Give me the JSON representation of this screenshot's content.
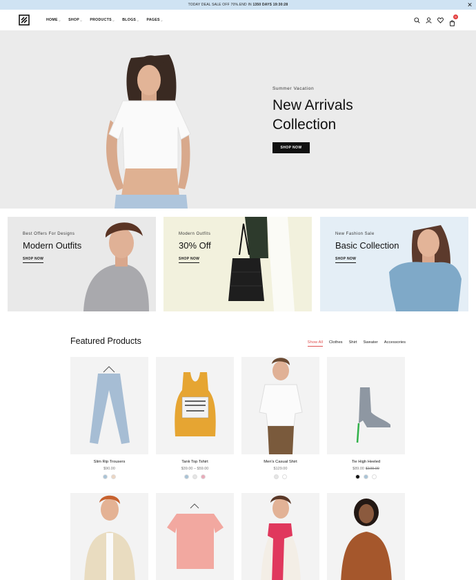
{
  "announcement": {
    "text_prefix": "TODAY DEAL SALE OFF 70%.END IN",
    "countdown": "1350 DAYS 19:30:28"
  },
  "header": {
    "nav": [
      {
        "label": "HOME"
      },
      {
        "label": "SHOP"
      },
      {
        "label": "PRODUCTS"
      },
      {
        "label": "BLOGS"
      },
      {
        "label": "PAGES"
      }
    ],
    "cart_count": "0"
  },
  "hero": {
    "subtitle": "Summer Vacation",
    "title": "New Arrivals Collection",
    "button": "SHOP NOW"
  },
  "promos": [
    {
      "subtitle": "Best Offers For Designs",
      "title": "Modern Outfits",
      "link": "SHOP NOW",
      "bg": "#e9e9e9"
    },
    {
      "subtitle": "Modern Outfits",
      "title": "30% Off",
      "link": "SHOP NOW",
      "bg": "#f2f1dd"
    },
    {
      "subtitle": "New Fashion Sale",
      "title": "Basic Collection",
      "link": "SHOP NOW",
      "bg": "#e4eef6"
    }
  ],
  "featured": {
    "title": "Featured Products",
    "tabs": [
      "Show All",
      "Clothes",
      "Shirt",
      "Sweater",
      "Accessories"
    ]
  },
  "products": [
    {
      "name": "Slim Rip Trousers",
      "price": "$90.00",
      "old_price": "",
      "swatches": [
        "#a9c3d6",
        "#ecd6c3"
      ]
    },
    {
      "name": "Tank Top Tshirt",
      "price": "$39.00 – $59.00",
      "old_price": "",
      "swatches": [
        "#a9c3d6",
        "#e5e5e5",
        "#e8aab8"
      ]
    },
    {
      "name": "Men's Casual Shirt",
      "price": "$129.00",
      "old_price": "",
      "swatches": [
        "#e5e5e5",
        "#ffffff"
      ]
    },
    {
      "name": "Tie High Heeled",
      "price": "$89.00",
      "old_price": "$109.00",
      "swatches": [
        "#111111",
        "#a9c3d6",
        "#ffffff"
      ]
    }
  ]
}
